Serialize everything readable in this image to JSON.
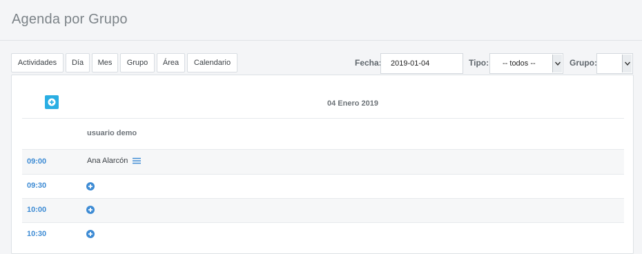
{
  "page": {
    "title": "Agenda por Grupo"
  },
  "toolbar": {
    "buttons": [
      "Actividades",
      "Día",
      "Mes",
      "Grupo",
      "Área",
      "Calendario"
    ]
  },
  "filters": {
    "fecha_label": "Fecha:",
    "fecha_value": "2019-01-04",
    "tipo_label": "Tipo:",
    "tipo_value": "-- todos --",
    "grupo_label": "Grupo:",
    "grupo_value": ""
  },
  "agenda": {
    "date": "04 Enero 2019",
    "user": "usuario demo",
    "rows": [
      {
        "time": "09:00",
        "event": "Ana Alarcón"
      },
      {
        "time": "09:30",
        "event": ""
      },
      {
        "time": "10:00",
        "event": ""
      },
      {
        "time": "10:30",
        "event": ""
      }
    ]
  },
  "colors": {
    "accent_blue": "#3d8bd4",
    "add_button": "#2aaee3"
  },
  "icons": {
    "add": "plus-circle-icon",
    "menu": "hamburger-icon",
    "dropdown": "chevron-down-icon"
  }
}
